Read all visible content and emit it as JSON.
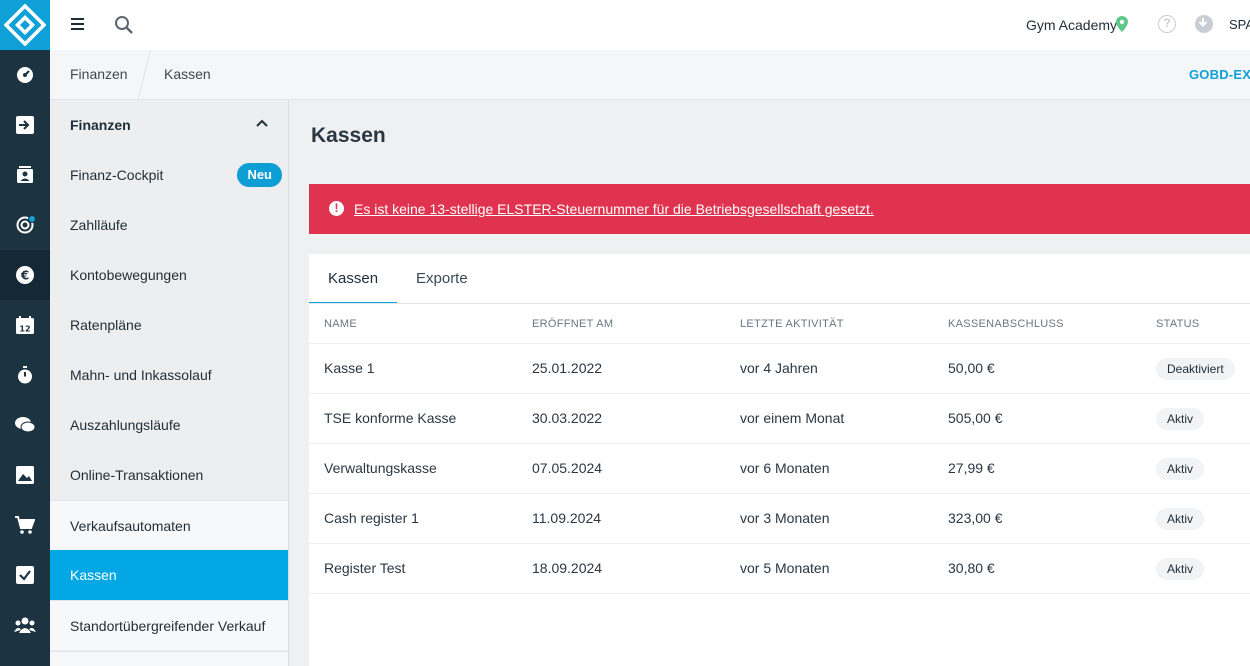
{
  "topbar": {
    "studio": "Gym Academy",
    "user_truncated": "SPA",
    "help_glyph": "?"
  },
  "breadcrumb": [
    "Finanzen",
    "Kassen"
  ],
  "header_action": "GOBD-EXP",
  "sidebar": {
    "section": "Finanzen",
    "items": [
      {
        "label": "Finanz-Cockpit",
        "badge": "Neu"
      },
      {
        "label": "Zahlläufe"
      },
      {
        "label": "Kontobewegungen"
      },
      {
        "label": "Ratenpläne"
      },
      {
        "label": "Mahn- und Inkassolauf"
      },
      {
        "label": "Auszahlungsläufe"
      },
      {
        "label": "Online-Transaktionen"
      },
      {
        "label": "Verkaufsautomaten"
      },
      {
        "label": "Kassen"
      },
      {
        "label": "Standortübergreifender Verkauf"
      }
    ]
  },
  "page": {
    "title": "Kassen",
    "alert": "Es ist keine 13-stellige ELSTER-Steuernummer für die Betriebsgesellschaft gesetzt.",
    "alert_glyph": "!",
    "tabs": [
      "Kassen",
      "Exporte"
    ],
    "columns": [
      "NAME",
      "ERÖFFNET AM",
      "LETZTE AKTIVITÄT",
      "KASSENABSCHLUSS",
      "STATUS"
    ],
    "rows": [
      {
        "name": "Kasse 1",
        "opened": "25.01.2022",
        "activity": "vor 4 Jahren",
        "closing": "50,00 €",
        "status": "Deaktiviert"
      },
      {
        "name": "TSE konforme Kasse",
        "opened": "30.03.2022",
        "activity": "vor einem Monat",
        "closing": "505,00 €",
        "status": "Aktiv"
      },
      {
        "name": "Verwaltungskasse",
        "opened": "07.05.2024",
        "activity": "vor 6 Monaten",
        "closing": "27,99 €",
        "status": "Aktiv"
      },
      {
        "name": "Cash register 1",
        "opened": "11.09.2024",
        "activity": "vor 3 Monaten",
        "closing": "323,00 €",
        "status": "Aktiv"
      },
      {
        "name": "Register Test",
        "opened": "18.09.2024",
        "activity": "vor 5 Monaten",
        "closing": "30,80 €",
        "status": "Aktiv"
      }
    ]
  },
  "colors": {
    "rail": "#1c3342",
    "accent": "#0fa0d8",
    "alert": "#e0334f",
    "location_pin": "#5dc88a"
  },
  "icons": {
    "rail": [
      "dashboard-icon",
      "check-in-icon",
      "contacts-icon",
      "target-icon",
      "euro-icon",
      "calendar-icon",
      "stopwatch-icon",
      "chat-icon",
      "image-icon",
      "cart-icon",
      "task-icon",
      "group-icon"
    ]
  }
}
